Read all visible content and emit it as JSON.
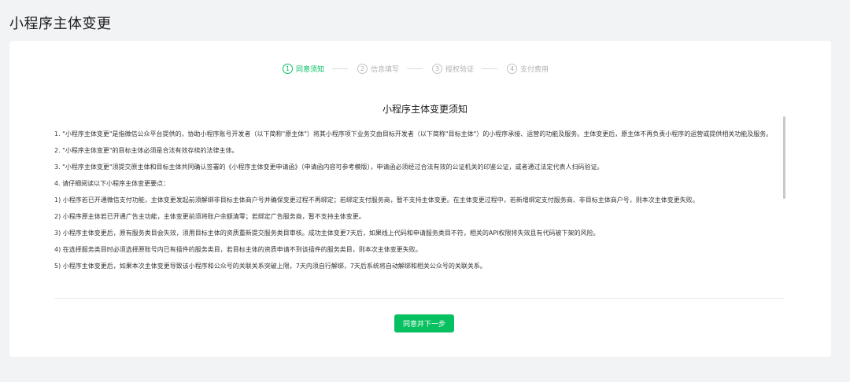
{
  "page": {
    "title": "小程序主体变更"
  },
  "steps": [
    {
      "num": "1",
      "label": "同意须知",
      "active": true
    },
    {
      "num": "2",
      "label": "信息填写",
      "active": false
    },
    {
      "num": "3",
      "label": "授权验证",
      "active": false
    },
    {
      "num": "4",
      "label": "支付费用",
      "active": false
    }
  ],
  "notice": {
    "title": "小程序主体变更须知",
    "items": [
      "1. \"小程序主体变更\"是指微信公众平台提供的，协助小程序账号开发者（以下简称\"原主体\"）将其小程序项下业务交由目标开发者（以下简称\"目标主体\"）的小程序承接、运营的功能及服务。主体变更后，原主体不再负责小程序的运营或提供相关功能及服务。",
      "2. \"小程序主体变更\"的目标主体必须是合法有效存续的法律主体。",
      "3. \"小程序主体变更\"须提交原主体和目标主体共同确认签署的《小程序主体变更申请函》（申请函内容可参考模版），申请函必须经过合法有效的公证机关的印鉴公证，或者通过法定代表人扫码验证。",
      "4. 请仔细阅读以下小程序主体变更要点：",
      "1) 小程序若已开通微信支付功能，主体变更发起前须解绑非目标主体商户号并确保变更过程不再绑定；若绑定支付服务商，暂不支持主体变更。在主体变更过程中，若新增绑定支付服务商、非目标主体商户号，则本次主体变更失败。",
      "2) 小程序原主体若已开通广告主功能，主体变更前须将账户余额清零；若绑定广告服务商，暂不支持主体变更。",
      "3) 小程序主体变更后，原有服务类目会失效，须用目标主体的资质重新提交服务类目审核。成功主体变更7天后，如果线上代码和申请服务类目不符，相关的API权限将失效且有代码被下架的风险。",
      "4) 在选择服务类目时必须选择原账号内已有插件的服务类目，若目标主体的资质申请不到该插件的服务类目，则本次主体变更失败。",
      "5) 小程序主体变更后，如果本次主体变更导致该小程序和公众号的关联关系突破上限，7天内须自行解绑，7天后系统将自动解绑和相关公众号的关联关系。"
    ]
  },
  "actions": {
    "agree_label": "同意并下一步"
  },
  "colors": {
    "accent": "#07c160",
    "background": "#f2f3f5"
  }
}
